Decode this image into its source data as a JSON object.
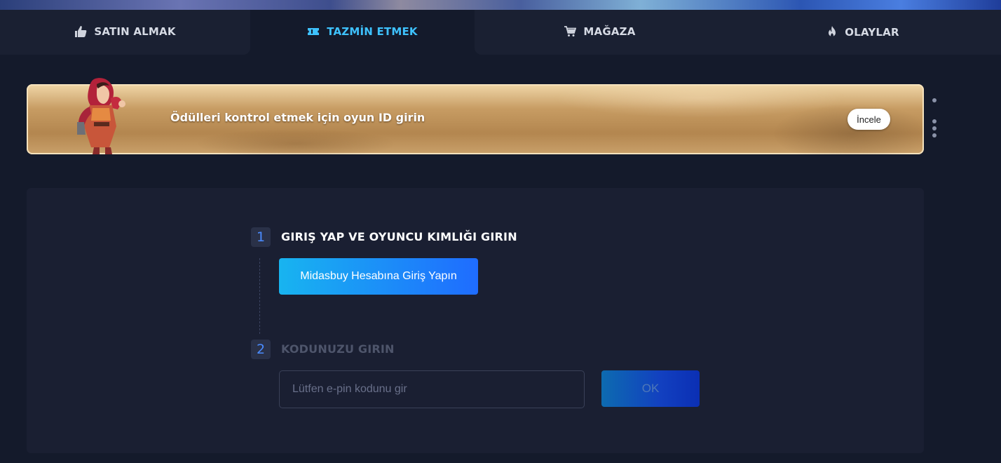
{
  "nav": {
    "tabs": [
      {
        "label": "SATIN ALMAK",
        "icon": "thumbs-up-icon",
        "active": false
      },
      {
        "label": "TAZMİN ETMEK",
        "icon": "ticket-icon",
        "active": true
      },
      {
        "label": "MAĞAZA",
        "icon": "cart-icon",
        "active": false
      },
      {
        "label": "OLAYLAR",
        "icon": "flame-icon",
        "active": false
      }
    ]
  },
  "banner": {
    "text": "Ödülleri kontrol etmek için oyun ID girin",
    "button_label": "İncele"
  },
  "steps": [
    {
      "number": "1",
      "title": "GIRIŞ YAP VE OYUNCU KIMLIĞI GIRIN",
      "button_label": "Midasbuy Hesabına Giriş Yapın"
    },
    {
      "number": "2",
      "title": "KODUNUZU GIRIN",
      "input_placeholder": "Lütfen e-pin kodunu gir",
      "submit_label": "OK"
    }
  ],
  "colors": {
    "background": "#141a2b",
    "panel": "#1a1f32",
    "active_tab": "#3ec2ff",
    "accent_blue": "#1f6cff",
    "step_number": "#4a8bff"
  }
}
